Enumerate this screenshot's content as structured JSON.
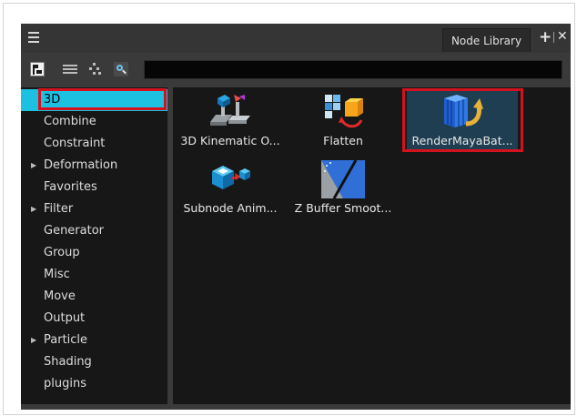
{
  "panel": {
    "tab_label": "Node Library",
    "add_icon": "plus-icon",
    "close_icon": "close-icon",
    "menu_icon": "hamburger-menu-icon"
  },
  "toolbar": {
    "search_value": "",
    "buttons": [
      "tree-view-icon",
      "list-view-icon",
      "hierarchy-view-icon",
      "search-icon"
    ]
  },
  "sidebar": {
    "items": [
      {
        "label": "3D",
        "expandable": false,
        "selected": true
      },
      {
        "label": "Combine",
        "expandable": false
      },
      {
        "label": "Constraint",
        "expandable": false
      },
      {
        "label": "Deformation",
        "expandable": true
      },
      {
        "label": "Favorites",
        "expandable": false
      },
      {
        "label": "Filter",
        "expandable": true
      },
      {
        "label": "Generator",
        "expandable": false
      },
      {
        "label": "Group",
        "expandable": false
      },
      {
        "label": "Misc",
        "expandable": false
      },
      {
        "label": "Move",
        "expandable": false
      },
      {
        "label": "Output",
        "expandable": false
      },
      {
        "label": "Particle",
        "expandable": true
      },
      {
        "label": "Shading",
        "expandable": false
      },
      {
        "label": "plugins",
        "expandable": false
      }
    ]
  },
  "nodes": [
    {
      "label": "3D Kinematic O...",
      "icon": "3d-kinematic-output-icon"
    },
    {
      "label": "Flatten",
      "icon": "flatten-icon"
    },
    {
      "label": "RenderMayaBat...",
      "icon": "render-maya-batch-icon",
      "selected": true
    },
    {
      "label": "Subnode Anim...",
      "icon": "subnode-animation-icon"
    },
    {
      "label": "Z Buffer Smoot...",
      "icon": "z-buffer-smoothing-icon"
    }
  ],
  "colors": {
    "panel_bg": "#3a3a3a",
    "list_bg": "#171717",
    "selection": "#1cc0e0",
    "highlight_border": "#d4121e"
  }
}
